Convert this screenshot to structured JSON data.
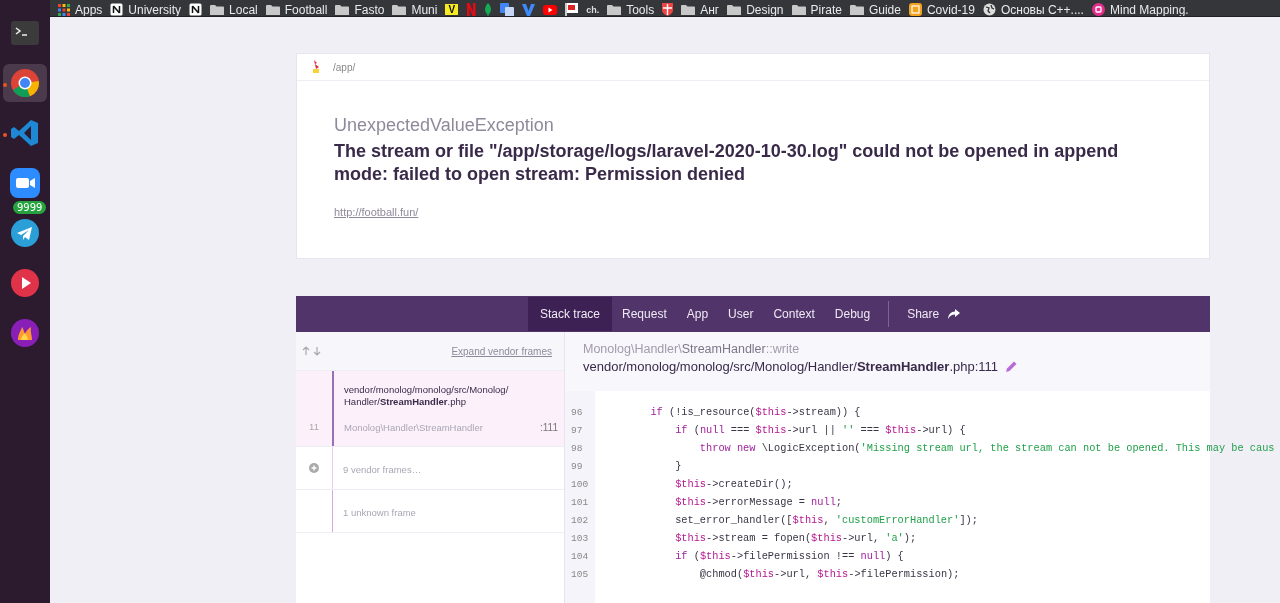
{
  "dock": [
    {
      "kind": "terminal",
      "selected": false,
      "running": false
    },
    {
      "kind": "chrome",
      "selected": true,
      "running": true
    },
    {
      "kind": "vscode",
      "selected": false,
      "running": true
    },
    {
      "kind": "zoom",
      "selected": false,
      "running": false
    },
    {
      "kind": "telegram",
      "selected": false,
      "running": false,
      "badge": "9999"
    },
    {
      "kind": "player",
      "selected": false,
      "running": false
    },
    {
      "kind": "flame",
      "selected": false,
      "running": false
    }
  ],
  "bookmarks": [
    {
      "kind": "apps",
      "label": "Apps"
    },
    {
      "kind": "notion",
      "label": "University"
    },
    {
      "kind": "notion"
    },
    {
      "kind": "folder",
      "label": "Local"
    },
    {
      "kind": "folder",
      "label": "Football"
    },
    {
      "kind": "folder",
      "label": "Fasto"
    },
    {
      "kind": "folder",
      "label": "Muni"
    },
    {
      "kind": "lettermark",
      "mark": "V"
    },
    {
      "kind": "netflix"
    },
    {
      "kind": "leaf"
    },
    {
      "kind": "translate"
    },
    {
      "kind": "vee"
    },
    {
      "kind": "youtube"
    },
    {
      "kind": "flag"
    },
    {
      "kind": "textmark",
      "mark": "ch."
    },
    {
      "kind": "folder",
      "label": "Tools"
    },
    {
      "kind": "shield"
    },
    {
      "kind": "folder",
      "label": "Анг"
    },
    {
      "kind": "folder",
      "label": "Design"
    },
    {
      "kind": "folder",
      "label": "Pirate"
    },
    {
      "kind": "folder",
      "label": "Guide"
    },
    {
      "kind": "covid",
      "label": "Covid-19"
    },
    {
      "kind": "globe",
      "label": "Основы C++...."
    },
    {
      "kind": "mind",
      "label": "Mind Mapping."
    }
  ],
  "header": {
    "path": "/app/",
    "exception_class": "UnexpectedValueException",
    "message": "The stream or file \"/app/storage/logs/laravel-2020-10-30.log\" could not be opened in append mode: failed to open stream: Permission denied",
    "url": "http://football.fun/"
  },
  "tabs": [
    {
      "label": "Stack trace",
      "selected": true
    },
    {
      "label": "Request",
      "selected": false
    },
    {
      "label": "App",
      "selected": false
    },
    {
      "label": "User",
      "selected": false
    },
    {
      "label": "Context",
      "selected": false
    },
    {
      "label": "Debug",
      "selected": false
    }
  ],
  "share": {
    "label": "Share"
  },
  "frames_panel": {
    "expand_label": "Expand vendor frames"
  },
  "frames": [
    {
      "kind": "app",
      "selected": true,
      "file": "vendor/monolog/monolog/src/Monolog/Handler/**StreamHandler**.php",
      "number": "11",
      "class": "Monolog\\Handler\\StreamHandler",
      "line": ":111"
    },
    {
      "kind": "vendor",
      "selected": false,
      "label": "9 vendor frames…"
    },
    {
      "kind": "unknown",
      "selected": false,
      "label": "1 unknown frame"
    }
  ],
  "code_header": {
    "method": "Monolog\\Handler\\**StreamHandler**::write",
    "file": "vendor/monolog/monolog/src/Monolog/Handler/**StreamHandler**.php:111"
  },
  "code": [
    {
      "number": "96",
      "tokens": [
        {
          "kind": "kw",
          "text": "        if"
        },
        {
          "kind": "plain",
          "text": " (!is_resource("
        },
        {
          "kind": "var",
          "text": "$this"
        },
        {
          "kind": "plain",
          "text": "->stream)) {"
        }
      ]
    },
    {
      "number": "97",
      "tokens": [
        {
          "kind": "kw",
          "text": "            if"
        },
        {
          "kind": "plain",
          "text": " ("
        },
        {
          "kind": "kw",
          "text": "null"
        },
        {
          "kind": "plain",
          "text": " === "
        },
        {
          "kind": "var",
          "text": "$this"
        },
        {
          "kind": "plain",
          "text": "->url || "
        },
        {
          "kind": "str",
          "text": "''"
        },
        {
          "kind": "plain",
          "text": " === "
        },
        {
          "kind": "var",
          "text": "$this"
        },
        {
          "kind": "plain",
          "text": "->url) {"
        }
      ]
    },
    {
      "number": "98",
      "tokens": [
        {
          "kind": "kw",
          "text": "                throw new"
        },
        {
          "kind": "plain",
          "text": " \\LogicException("
        },
        {
          "kind": "str",
          "text": "'Missing stream url, the stream can not be opened. This may be caus"
        }
      ]
    },
    {
      "number": "99",
      "tokens": [
        {
          "kind": "plain",
          "text": "            }"
        }
      ]
    },
    {
      "number": "100",
      "tokens": [
        {
          "kind": "var",
          "text": "            $this"
        },
        {
          "kind": "plain",
          "text": "->createDir();"
        }
      ]
    },
    {
      "number": "101",
      "tokens": [
        {
          "kind": "var",
          "text": "            $this"
        },
        {
          "kind": "plain",
          "text": "->errorMessage = "
        },
        {
          "kind": "kw",
          "text": "null"
        },
        {
          "kind": "plain",
          "text": ";"
        }
      ]
    },
    {
      "number": "102",
      "tokens": [
        {
          "kind": "plain",
          "text": "            set_error_handler(["
        },
        {
          "kind": "var",
          "text": "$this"
        },
        {
          "kind": "plain",
          "text": ", "
        },
        {
          "kind": "str",
          "text": "'customErrorHandler'"
        },
        {
          "kind": "plain",
          "text": "]);"
        }
      ]
    },
    {
      "number": "103",
      "tokens": [
        {
          "kind": "var",
          "text": "            $this"
        },
        {
          "kind": "plain",
          "text": "->stream = fopen("
        },
        {
          "kind": "var",
          "text": "$this"
        },
        {
          "kind": "plain",
          "text": "->url, "
        },
        {
          "kind": "str",
          "text": "'a'"
        },
        {
          "kind": "plain",
          "text": ");"
        }
      ]
    },
    {
      "number": "104",
      "tokens": [
        {
          "kind": "kw",
          "text": "            if"
        },
        {
          "kind": "plain",
          "text": " ("
        },
        {
          "kind": "var",
          "text": "$this"
        },
        {
          "kind": "plain",
          "text": "->filePermission !== "
        },
        {
          "kind": "kw",
          "text": "null"
        },
        {
          "kind": "plain",
          "text": ") {"
        }
      ]
    },
    {
      "number": "105",
      "tokens": [
        {
          "kind": "plain",
          "text": "                @chmod("
        },
        {
          "kind": "var",
          "text": "$this"
        },
        {
          "kind": "plain",
          "text": "->url, "
        },
        {
          "kind": "var",
          "text": "$this"
        },
        {
          "kind": "plain",
          "text": "->filePermission);"
        }
      ]
    }
  ]
}
